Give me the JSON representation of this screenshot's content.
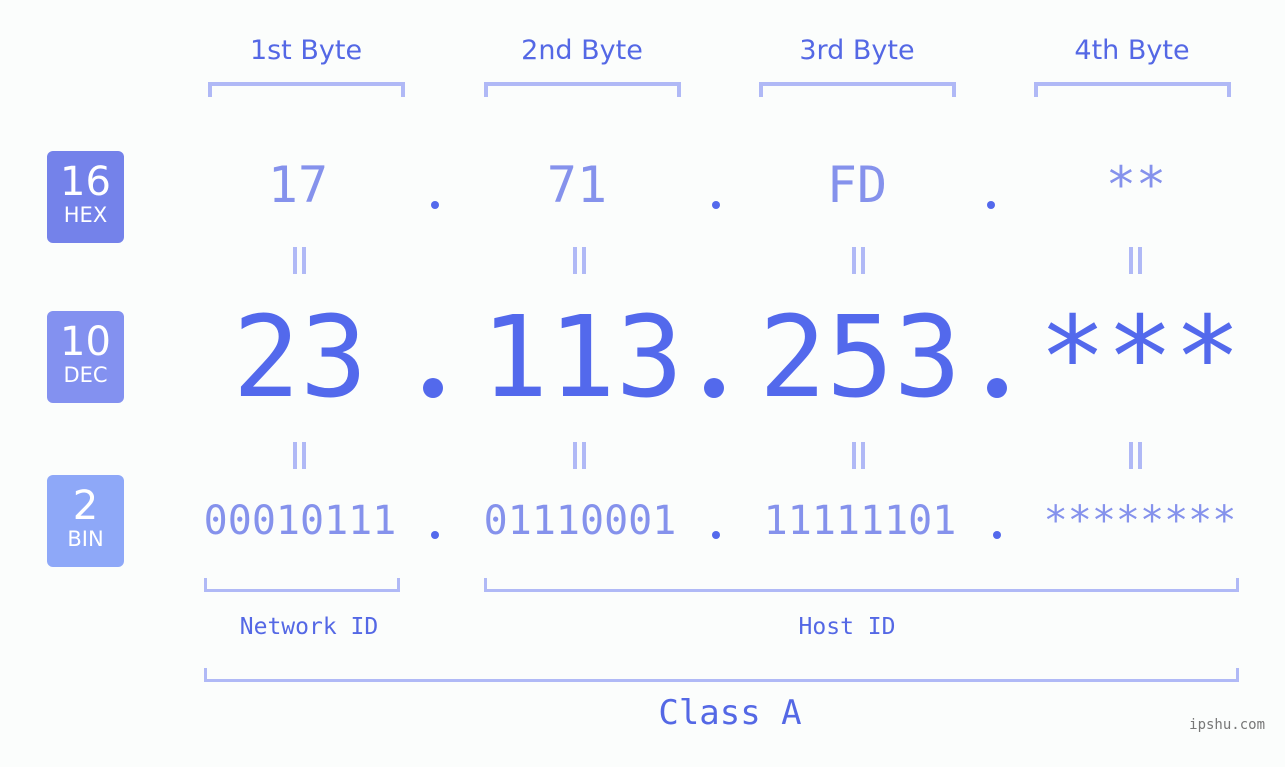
{
  "bytes": {
    "headers": [
      "1st Byte",
      "2nd Byte",
      "3rd Byte",
      "4th Byte"
    ]
  },
  "bases": {
    "hex": {
      "number": "16",
      "label": "HEX",
      "color": "#7482ea"
    },
    "dec": {
      "number": "10",
      "label": "DEC",
      "color": "#8391f0"
    },
    "bin": {
      "number": "2",
      "label": "BIN",
      "color": "#8ea8f8"
    }
  },
  "values": {
    "hex": [
      "17",
      "71",
      "FD",
      "**"
    ],
    "dec": [
      "23",
      "113",
      "253",
      "***"
    ],
    "bin": [
      "00010111",
      "01110001",
      "11111101",
      "********"
    ]
  },
  "separator": ".",
  "equals_symbol": "=",
  "segments": {
    "network_id": "Network ID",
    "host_id": "Host ID",
    "class": "Class A"
  },
  "colors": {
    "accent": "#5369ec",
    "light_value": "#8592ec",
    "bracket": "#b0b9f6"
  },
  "watermark": "ipshu.com"
}
